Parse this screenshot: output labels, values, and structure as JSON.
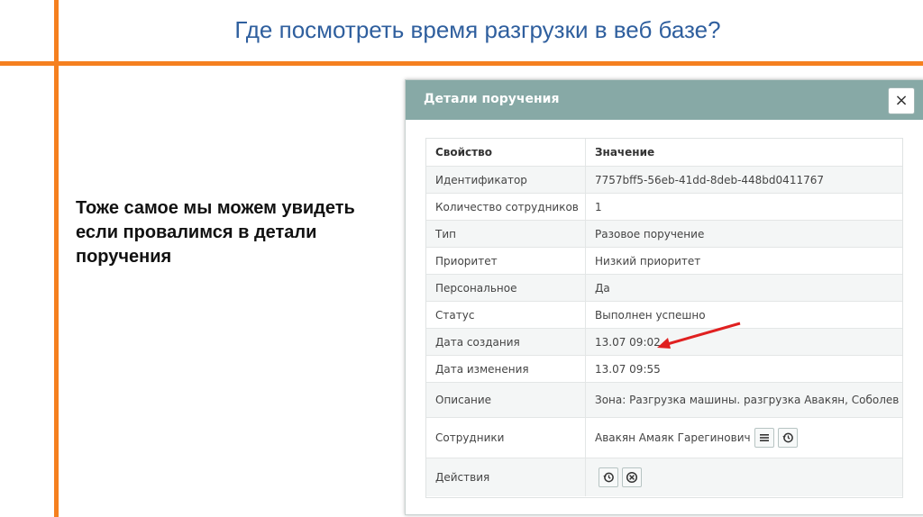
{
  "slide": {
    "title": "Где посмотреть время разгрузки в веб базе?",
    "text": "Тоже самое мы можем увидеть если провалимся в детали поручения"
  },
  "modal": {
    "title": "Детали поручения",
    "close_label": "×",
    "header": {
      "property": "Свойство",
      "value": "Значение"
    },
    "rows": [
      {
        "property": "Идентификатор",
        "value": "7757bff5-56eb-41dd-8deb-448bd0411767"
      },
      {
        "property": "Количество сотрудников",
        "value": "1"
      },
      {
        "property": "Тип",
        "value": "Разовое поручение"
      },
      {
        "property": "Приоритет",
        "value": "Низкий приоритет"
      },
      {
        "property": "Персональное",
        "value": "Да"
      },
      {
        "property": "Статус",
        "value": "Выполнен успешно"
      },
      {
        "property": "Дата создания",
        "value": "13.07 09:02"
      },
      {
        "property": "Дата изменения",
        "value": "13.07 09:55"
      },
      {
        "property": "Описание",
        "value": "Зона: Разгрузка машины. разгрузка Авакян, Соболев"
      },
      {
        "property": "Сотрудники",
        "value": "Авакян Амаяк Гарегинович"
      },
      {
        "property": "Действия",
        "value": ""
      }
    ]
  },
  "colors": {
    "accent": "#f5801f",
    "title_blue": "#2f5f9e",
    "modal_header": "#87a9a6",
    "arrow_red": "#e02020"
  }
}
